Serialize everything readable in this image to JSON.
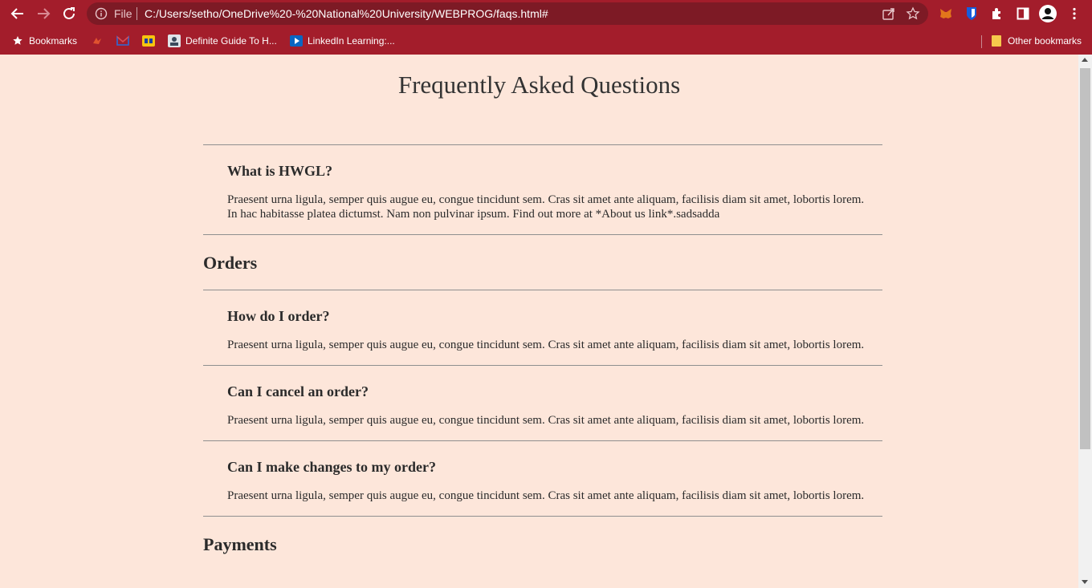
{
  "browser": {
    "scheme": "File",
    "url": "C:/Users/setho/OneDrive%20-%20National%20University/WEBPROG/faqs.html#",
    "bookmarks": [
      {
        "label": "Bookmarks",
        "icon": "star-icon"
      },
      {
        "label": "",
        "icon": "bird-icon"
      },
      {
        "label": "",
        "icon": "mail-icon"
      },
      {
        "label": "",
        "icon": "badge-icon"
      },
      {
        "label": "Definite Guide To H...",
        "icon": "video-thumb-icon"
      },
      {
        "label": "LinkedIn Learning:...",
        "icon": "play-icon"
      }
    ],
    "other_bookmarks": "Other bookmarks",
    "colors": {
      "chrome": "#a31d2b",
      "omnibox": "#7d1a25",
      "page_bg": "#fde6da"
    }
  },
  "page": {
    "title": "Frequently Asked Questions",
    "faqs_general": [
      {
        "q": "What is HWGL?",
        "a": "Praesent urna ligula, semper quis augue eu, congue tincidunt sem. Cras sit amet ante aliquam, facilisis diam sit amet, lobortis lorem. In hac habitasse platea dictumst. Nam non pulvinar ipsum. Find out more at *About us link*.sadsadda"
      }
    ],
    "orders_heading": "Orders",
    "faqs_orders": [
      {
        "q": "How do I order?",
        "a": "Praesent urna ligula, semper quis augue eu, congue tincidunt sem. Cras sit amet ante aliquam, facilisis diam sit amet, lobortis lorem."
      },
      {
        "q": "Can I cancel an order?",
        "a": "Praesent urna ligula, semper quis augue eu, congue tincidunt sem. Cras sit amet ante aliquam, facilisis diam sit amet, lobortis lorem."
      },
      {
        "q": "Can I make changes to my order?",
        "a": "Praesent urna ligula, semper quis augue eu, congue tincidunt sem. Cras sit amet ante aliquam, facilisis diam sit amet, lobortis lorem."
      }
    ],
    "next_heading": "Payments"
  }
}
